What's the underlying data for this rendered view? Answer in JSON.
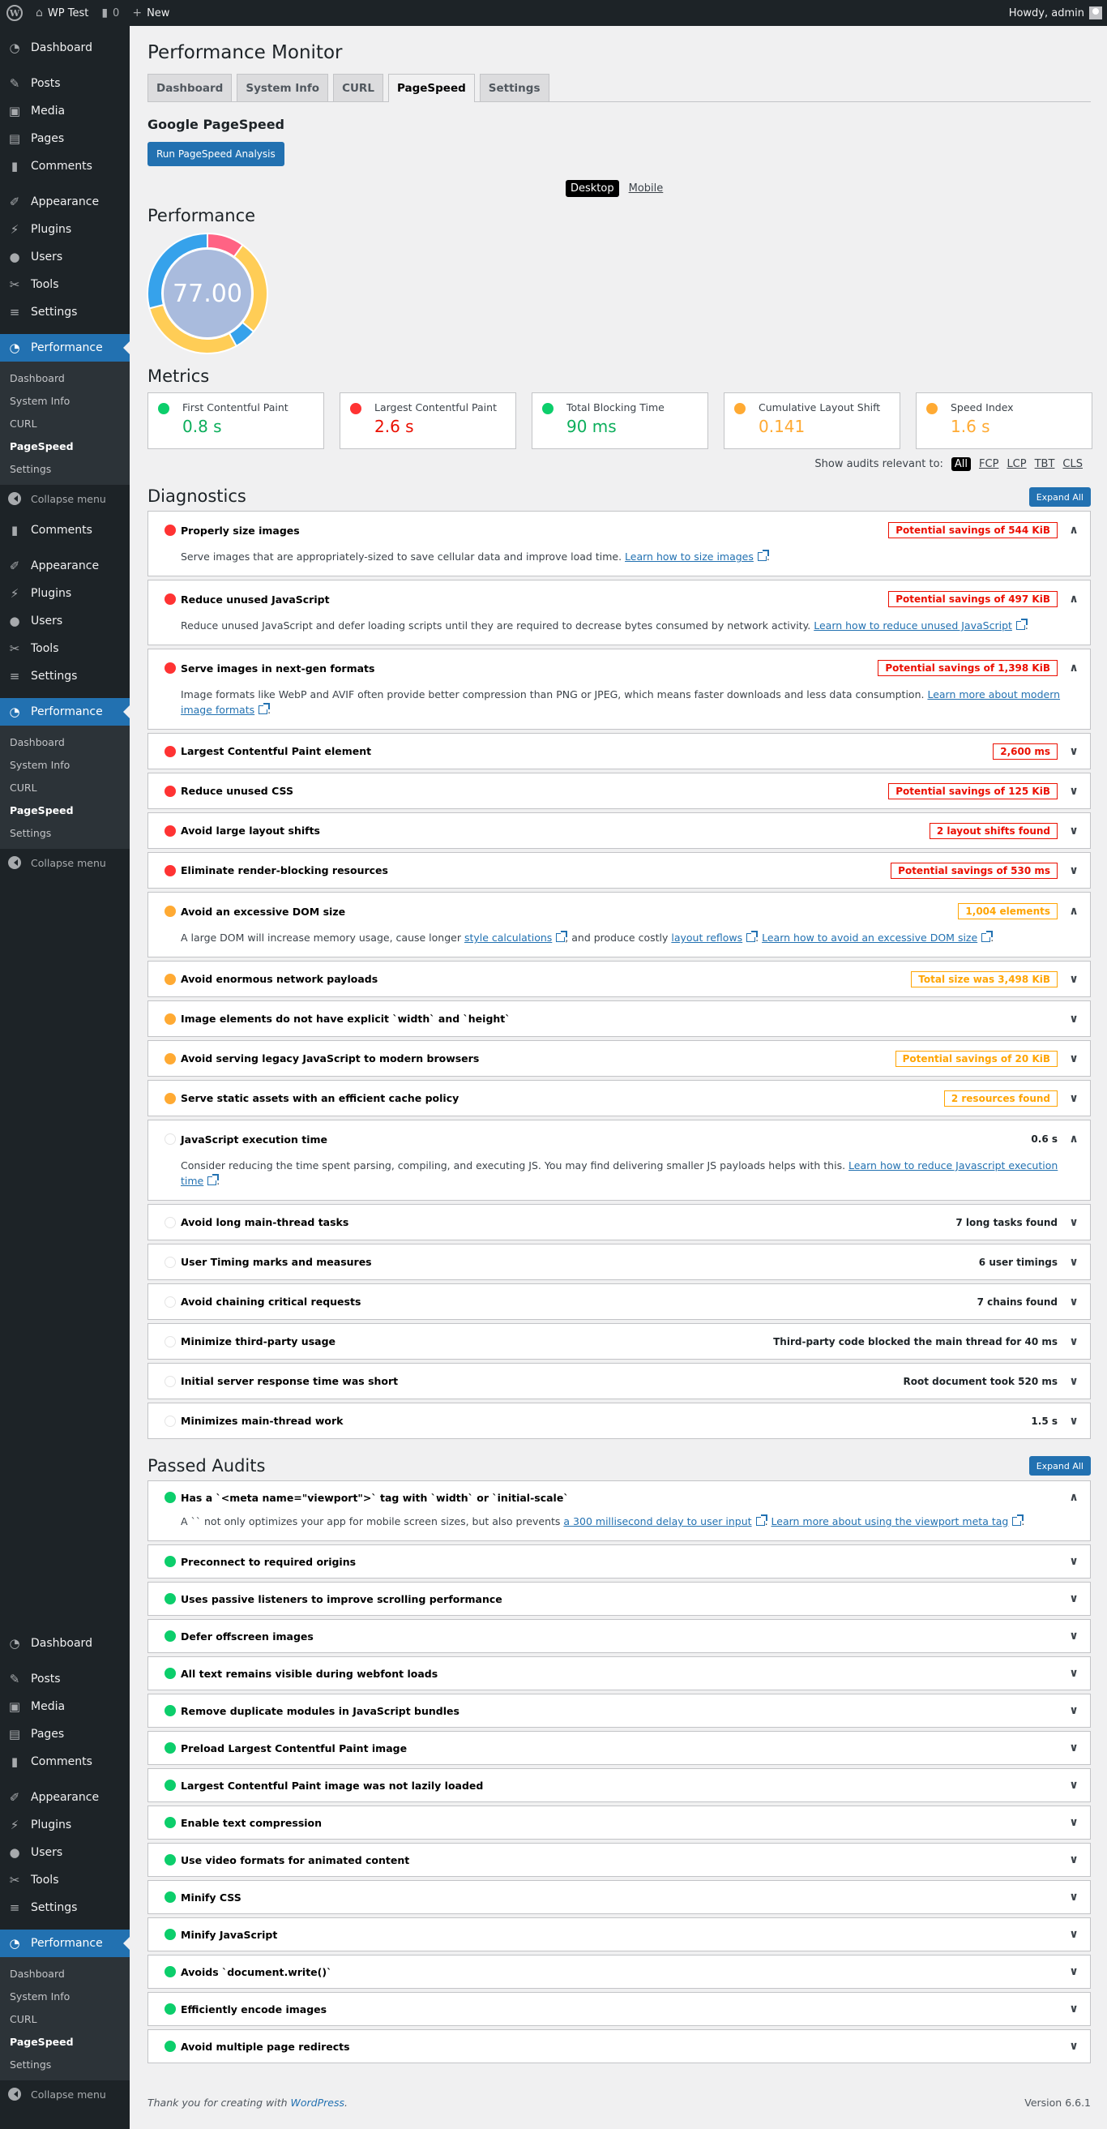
{
  "adminbar": {
    "site_name": "WP Test",
    "comments_count": "0",
    "new_label": "New",
    "greeting": "Howdy, admin"
  },
  "sidebar": {
    "main_items": [
      {
        "label": "Dashboard",
        "icon": "dashboard-icon"
      },
      {
        "label": "Posts",
        "icon": "pin-icon"
      },
      {
        "label": "Media",
        "icon": "media-icon"
      },
      {
        "label": "Pages",
        "icon": "pages-icon"
      },
      {
        "label": "Comments",
        "icon": "comment-icon"
      },
      {
        "label": "Appearance",
        "icon": "brush-icon"
      },
      {
        "label": "Plugins",
        "icon": "plugin-icon"
      },
      {
        "label": "Users",
        "icon": "user-icon"
      },
      {
        "label": "Tools",
        "icon": "wrench-icon"
      },
      {
        "label": "Settings",
        "icon": "settings-icon"
      }
    ],
    "performance_label": "Performance",
    "submenu": [
      "Dashboard",
      "System Info",
      "CURL",
      "PageSpeed",
      "Settings"
    ],
    "submenu_active": "PageSpeed",
    "collapse_label": "Collapse menu",
    "repeat_middle": [
      {
        "label": "Comments",
        "icon": "comment-icon"
      },
      {
        "label": "Appearance",
        "icon": "brush-icon"
      },
      {
        "label": "Plugins",
        "icon": "plugin-icon"
      },
      {
        "label": "Users",
        "icon": "user-icon"
      },
      {
        "label": "Tools",
        "icon": "wrench-icon"
      },
      {
        "label": "Settings",
        "icon": "settings-icon"
      }
    ]
  },
  "page": {
    "title": "Performance Monitor",
    "tabs": [
      "Dashboard",
      "System Info",
      "CURL",
      "PageSpeed",
      "Settings"
    ],
    "active_tab": "PageSpeed",
    "section_title": "Google PageSpeed",
    "run_button": "Run PageSpeed Analysis",
    "device_options": [
      "Desktop",
      "Mobile"
    ],
    "device_selected": "Desktop",
    "performance_heading": "Performance",
    "score": "77.00",
    "metrics_heading": "Metrics",
    "filter_label": "Show audits relevant to:",
    "filter_options": [
      "All",
      "FCP",
      "LCP",
      "TBT",
      "CLS"
    ],
    "filter_selected": "All",
    "diagnostics_heading": "Diagnostics",
    "passed_heading": "Passed Audits",
    "expand_all": "Expand All"
  },
  "colors": {
    "red": "#ff3333",
    "orange": "#ffaa33",
    "green": "#0cce6b",
    "blue": "#2271b1"
  },
  "chart_data": {
    "type": "pie",
    "title": "Performance",
    "center_label": "77.00",
    "segments": [
      {
        "color": "#ff6384",
        "value": 10
      },
      {
        "color": "#ffcd56",
        "value": 26
      },
      {
        "color": "#36a2eb",
        "value": 6
      },
      {
        "color": "#ffcd56",
        "value": 29
      },
      {
        "color": "#36a2eb",
        "value": 29
      }
    ]
  },
  "metrics": [
    {
      "label": "First Contentful Paint",
      "value": "0.8 s",
      "status": "green"
    },
    {
      "label": "Largest Contentful Paint",
      "value": "2.6 s",
      "status": "red"
    },
    {
      "label": "Total Blocking Time",
      "value": "90 ms",
      "status": "green"
    },
    {
      "label": "Cumulative Layout Shift",
      "value": "0.141",
      "status": "orange"
    },
    {
      "label": "Speed Index",
      "value": "1.6 s",
      "status": "orange"
    }
  ],
  "diagnostics": [
    {
      "title": "Properly size images",
      "status": "red",
      "badge": "Potential savings of 544 KiB",
      "expanded": true,
      "desc": [
        {
          "t": "Serve images that are appropriately-sized to save cellular data and improve load time. "
        },
        {
          "link": "Learn how to size images"
        },
        {
          "t": "."
        }
      ]
    },
    {
      "title": "Reduce unused JavaScript",
      "status": "red",
      "badge": "Potential savings of 497 KiB",
      "expanded": true,
      "desc": [
        {
          "t": "Reduce unused JavaScript and defer loading scripts until they are required to decrease bytes consumed by network activity. "
        },
        {
          "link": "Learn how to reduce unused JavaScript"
        },
        {
          "t": "."
        }
      ]
    },
    {
      "title": "Serve images in next-gen formats",
      "status": "red",
      "badge": "Potential savings of 1,398 KiB",
      "expanded": true,
      "desc": [
        {
          "t": "Image formats like WebP and AVIF often provide better compression than PNG or JPEG, which means faster downloads and less data consumption. "
        },
        {
          "link": "Learn more about modern image formats"
        },
        {
          "t": "."
        }
      ]
    },
    {
      "title": "Largest Contentful Paint element",
      "status": "red",
      "badge": "2,600 ms",
      "expanded": false
    },
    {
      "title": "Reduce unused CSS",
      "status": "red",
      "badge": "Potential savings of 125 KiB",
      "expanded": false
    },
    {
      "title": "Avoid large layout shifts",
      "status": "red",
      "badge": "2 layout shifts found",
      "expanded": false
    },
    {
      "title": "Eliminate render-blocking resources",
      "status": "red",
      "badge": "Potential savings of 530 ms",
      "expanded": false
    },
    {
      "title": "Avoid an excessive DOM size",
      "status": "orange",
      "badge": "1,004 elements",
      "expanded": true,
      "desc": [
        {
          "t": "A large DOM will increase memory usage, cause longer "
        },
        {
          "link": "style calculations"
        },
        {
          "t": ", and produce costly "
        },
        {
          "link": "layout reflows"
        },
        {
          "t": ". "
        },
        {
          "link": "Learn how to avoid an excessive DOM size"
        },
        {
          "t": "."
        }
      ]
    },
    {
      "title": "Avoid enormous network payloads",
      "status": "orange",
      "badge": "Total size was 3,498 KiB",
      "expanded": false
    },
    {
      "title": "Image elements do not have explicit `width` and `height`",
      "status": "orange",
      "badge": "",
      "expanded": false
    },
    {
      "title": "Avoid serving legacy JavaScript to modern browsers",
      "status": "orange",
      "badge": "Potential savings of 20 KiB",
      "expanded": false
    },
    {
      "title": "Serve static assets with an efficient cache policy",
      "status": "orange",
      "badge": "2 resources found",
      "expanded": false
    },
    {
      "title": "JavaScript execution time",
      "status": "neutral",
      "value": "0.6 s",
      "expanded": true,
      "desc": [
        {
          "t": "Consider reducing the time spent parsing, compiling, and executing JS. You may find delivering smaller JS payloads helps with this. "
        },
        {
          "link": "Learn how to reduce Javascript execution time"
        },
        {
          "t": "."
        }
      ]
    },
    {
      "title": "Avoid long main-thread tasks",
      "status": "neutral",
      "value": "7 long tasks found",
      "expanded": false
    },
    {
      "title": "User Timing marks and measures",
      "status": "neutral",
      "value": "6 user timings",
      "expanded": false
    },
    {
      "title": "Avoid chaining critical requests",
      "status": "neutral",
      "value": "7 chains found",
      "expanded": false
    },
    {
      "title": "Minimize third-party usage",
      "status": "neutral",
      "value": "Third-party code blocked the main thread for 40 ms",
      "expanded": false
    },
    {
      "title": "Initial server response time was short",
      "status": "neutral",
      "value": "Root document took 520 ms",
      "expanded": false
    },
    {
      "title": "Minimizes main-thread work",
      "status": "neutral",
      "value": "1.5 s",
      "expanded": false
    }
  ],
  "passed": [
    {
      "title": "Has a `<meta name=\"viewport\">` tag with `width` or `initial-scale`",
      "expanded": true,
      "desc": [
        {
          "t": "A `` not only optimizes your app for mobile screen sizes, but also prevents "
        },
        {
          "link": "a 300 millisecond delay to user input"
        },
        {
          "t": ". "
        },
        {
          "link": "Learn more about using the viewport meta tag"
        },
        {
          "t": "."
        }
      ]
    },
    {
      "title": "Preconnect to required origins"
    },
    {
      "title": "Uses passive listeners to improve scrolling performance"
    },
    {
      "title": "Defer offscreen images"
    },
    {
      "title": "All text remains visible during webfont loads"
    },
    {
      "title": "Remove duplicate modules in JavaScript bundles"
    },
    {
      "title": "Preload Largest Contentful Paint image"
    },
    {
      "title": "Largest Contentful Paint image was not lazily loaded"
    },
    {
      "title": "Enable text compression"
    },
    {
      "title": "Use video formats for animated content"
    },
    {
      "title": "Minify CSS"
    },
    {
      "title": "Minify JavaScript"
    },
    {
      "title": "Avoids `document.write()`"
    },
    {
      "title": "Efficiently encode images"
    },
    {
      "title": "Avoid multiple page redirects"
    }
  ],
  "footer": {
    "thanks": "Thank you for creating with ",
    "wp_link": "WordPress",
    "version": "Version 6.6.1"
  }
}
